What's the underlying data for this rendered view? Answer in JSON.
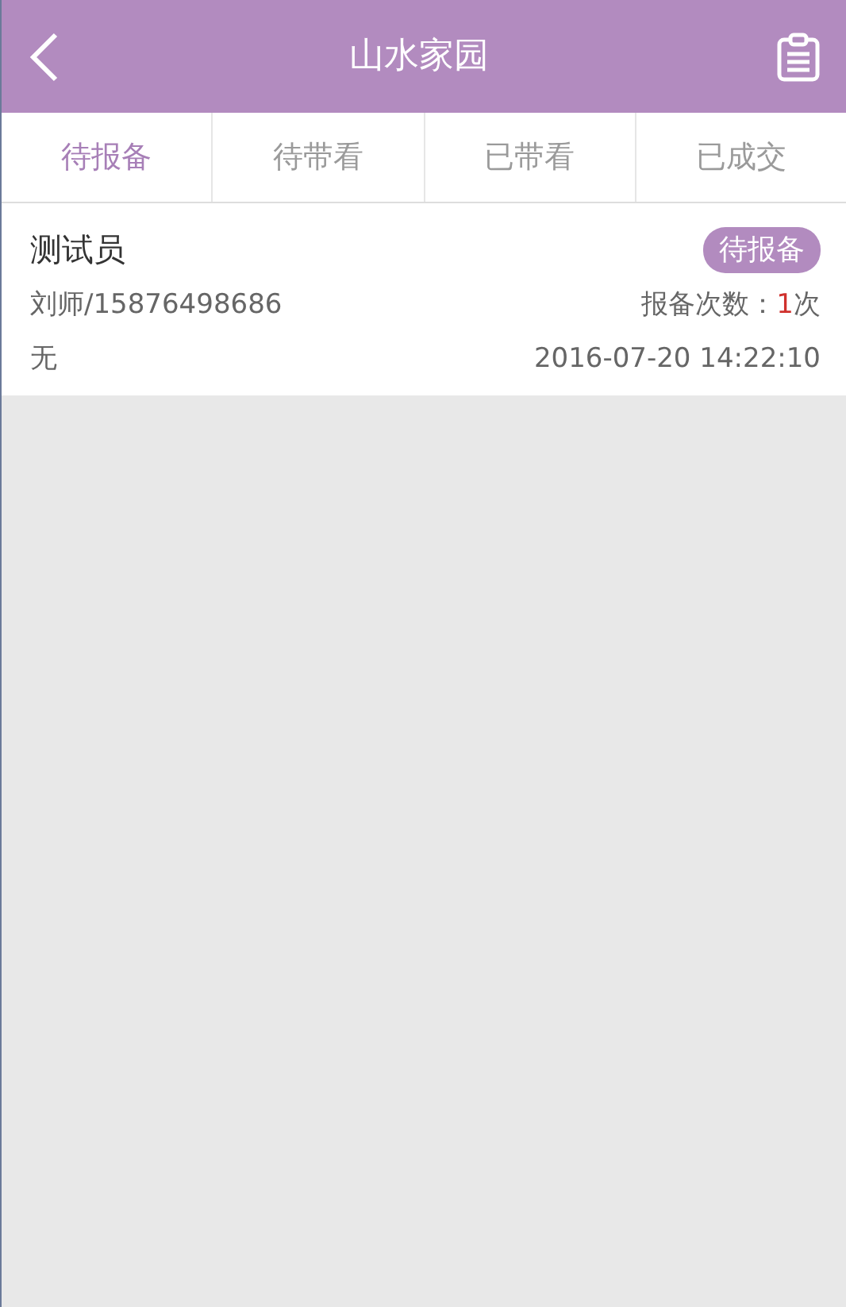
{
  "header": {
    "title": "山水家园"
  },
  "tabs": [
    {
      "label": "待报备",
      "selected": true
    },
    {
      "label": "待带看",
      "selected": false
    },
    {
      "label": "已带看",
      "selected": false
    },
    {
      "label": "已成交",
      "selected": false
    }
  ],
  "records": [
    {
      "name": "测试员",
      "status": "待报备",
      "agent": "刘师/15876498686",
      "count_label": "报备次数：",
      "count": "1",
      "count_unit": "次",
      "note": "无",
      "time": "2016-07-20 14:22:10"
    }
  ]
}
